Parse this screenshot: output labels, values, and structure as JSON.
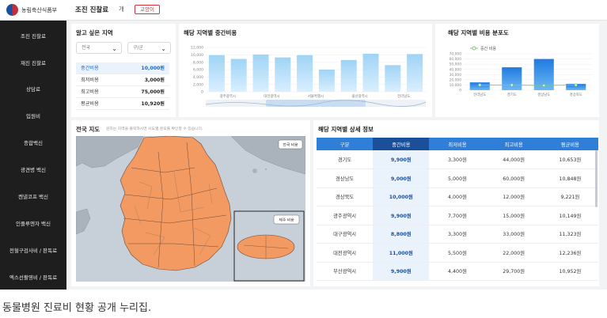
{
  "header": {
    "org_name": "농림축산식품부",
    "page_title": "조진 진찰료",
    "menu_short": "개",
    "badge": "고양이"
  },
  "sidebar": {
    "items": [
      {
        "label": "조진 진찰료"
      },
      {
        "label": "재진 진찰료"
      },
      {
        "label": "상담료"
      },
      {
        "label": "입원비"
      },
      {
        "label": "종합백신"
      },
      {
        "label": "광견병 백신"
      },
      {
        "label": "켄넬코프 백신"
      },
      {
        "label": "인플루엔자 백신"
      },
      {
        "label": "전혈구검사비 / 판독료"
      },
      {
        "label": "엑스선촬영비 / 판독료"
      }
    ]
  },
  "region_filter": {
    "title": "알고 싶은 지역",
    "province": "전국",
    "district": "구/군",
    "stats": [
      {
        "label": "중간비용",
        "value": "10,000원"
      },
      {
        "label": "최저비용",
        "value": "3,000원"
      },
      {
        "label": "최고비용",
        "value": "75,000원"
      },
      {
        "label": "평균비용",
        "value": "10,920원"
      }
    ]
  },
  "median_chart": {
    "title": "해당 지역별 중간비용",
    "tick_labels": [
      "12,000",
      "10,000",
      "8,000",
      "6,000",
      "4,000",
      "2,000",
      "0"
    ],
    "x_labels": [
      "광주광역시",
      "대전광역시",
      "서울특별시",
      "울산광역시",
      "전라남도"
    ]
  },
  "dist_chart": {
    "title": "해당 지역별 비용 분포도",
    "legend_label": "중간 비용",
    "tick_labels": [
      "70,000",
      "60,000",
      "50,000",
      "40,000",
      "30,000",
      "20,000",
      "10,000",
      "0"
    ],
    "x_labels": [
      "전라남도",
      "경기도",
      "경상남도",
      "경상북도"
    ]
  },
  "map": {
    "title": "전국 지도",
    "subtitle": "원하는 지역을 클릭하시면 시도별 분포를 확인할 수 있습니다.",
    "national_button": "전국 비용",
    "jeju_label": "제주 비용"
  },
  "detail_table": {
    "title": "해당 지역별 상세 정보",
    "headers": [
      "구분",
      "중간비용",
      "최저비용",
      "최고비용",
      "평균비용"
    ],
    "rows": [
      [
        "경기도",
        "9,900원",
        "3,300원",
        "44,000원",
        "10,653원"
      ],
      [
        "경상남도",
        "9,000원",
        "5,000원",
        "60,000원",
        "10,848원"
      ],
      [
        "경상북도",
        "10,000원",
        "4,000원",
        "12,000원",
        "9,221원"
      ],
      [
        "광주광역시",
        "9,900원",
        "7,700원",
        "15,000원",
        "10,149원"
      ],
      [
        "대구광역시",
        "8,800원",
        "3,300원",
        "33,000원",
        "11,323원"
      ],
      [
        "대전광역시",
        "11,000원",
        "5,500원",
        "22,000원",
        "12,236원"
      ],
      [
        "부산광역시",
        "9,900원",
        "4,400원",
        "29,700원",
        "10,952원"
      ]
    ]
  },
  "caption": "동물병원 진료비 현황 공개 누리집.",
  "colors": {
    "primary_blue": "#2f7fd9",
    "dark_blue": "#1b4f9a",
    "map_orange": "#f29a61",
    "sidebar_bg": "#1e1e1e",
    "badge_red": "#d2323e"
  },
  "chart_data": [
    {
      "type": "bar",
      "title": "해당 지역별 중간비용",
      "categories": [
        "",
        "광주광역시",
        "",
        "대전광역시",
        "",
        "서울특별시",
        "",
        "울산광역시",
        "",
        "전라남도"
      ],
      "values": [
        9900,
        8900,
        10100,
        9300,
        9900,
        6000,
        8600,
        10300,
        7200,
        10200
      ],
      "ylim": [
        0,
        12000
      ]
    },
    {
      "type": "bar",
      "title": "해당 지역별 비용 분포도",
      "categories": [
        "전라남도",
        "경기도",
        "경상남도",
        "경상북도"
      ],
      "series": [
        {
          "name": "중간 비용",
          "values": [
            10000,
            9900,
            9000,
            10000
          ]
        }
      ],
      "max_values": [
        15000,
        44000,
        60000,
        12000
      ],
      "ylim": [
        0,
        70000
      ]
    }
  ]
}
